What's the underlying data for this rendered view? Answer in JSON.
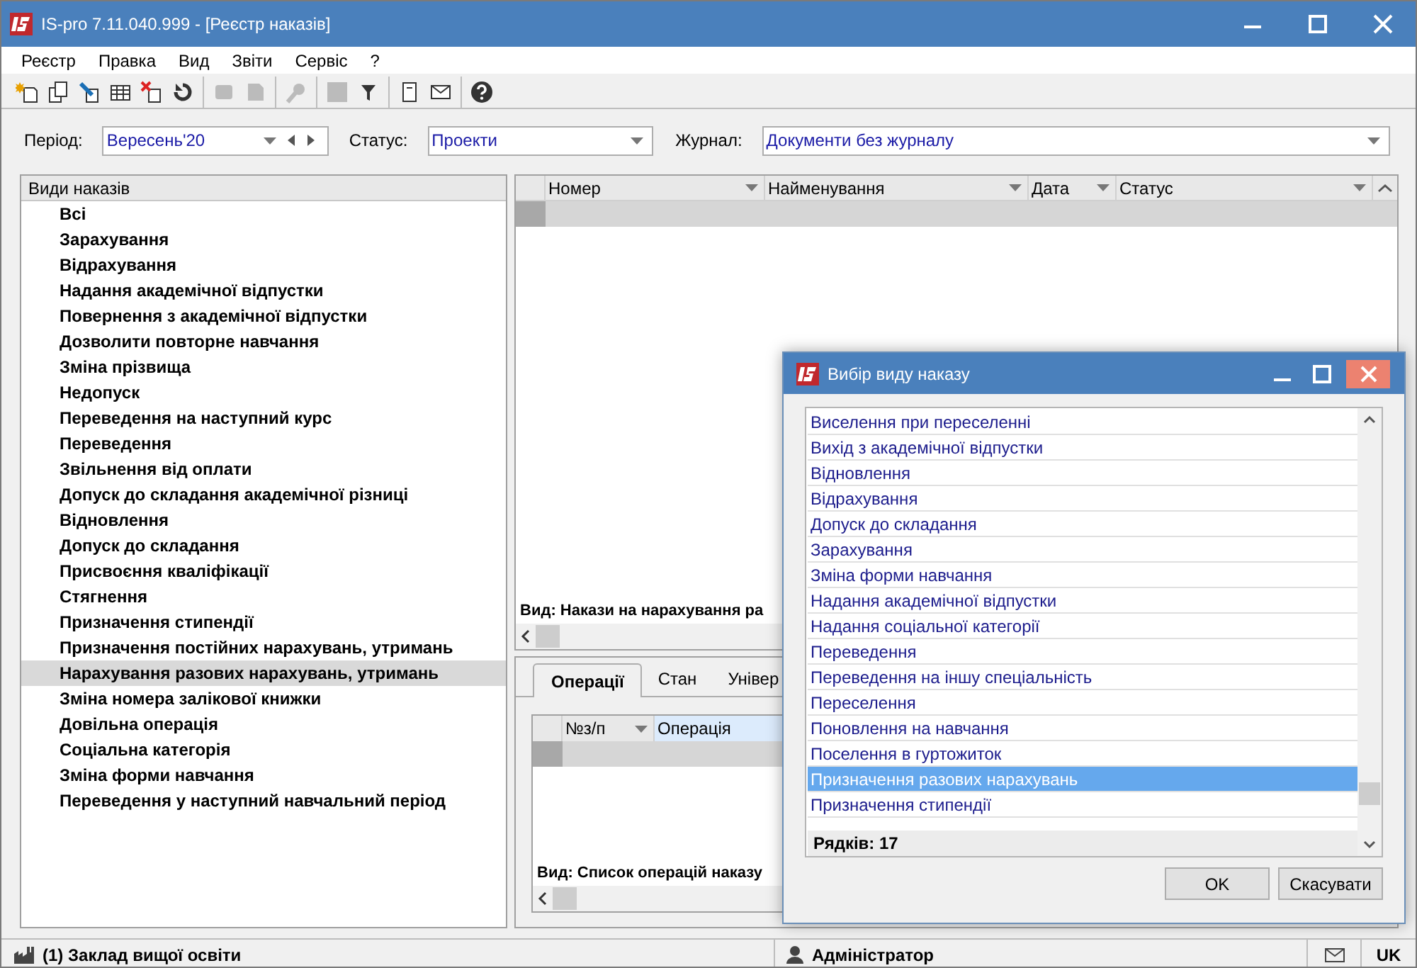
{
  "window": {
    "title": "IS-pro 7.11.040.999 - [Реєстр наказів]"
  },
  "menu": [
    "Реєстр",
    "Правка",
    "Вид",
    "Звіти",
    "Сервіс",
    "?"
  ],
  "toolbar": [
    {
      "disabled": false
    },
    {
      "disabled": false
    },
    {
      "disabled": false
    },
    {
      "disabled": false
    },
    {
      "disabled": false
    },
    {
      "disabled": false
    },
    {
      "disabled": true
    },
    {
      "disabled": true
    },
    {
      "disabled": true
    },
    {
      "disabled": true
    },
    {
      "disabled": false
    },
    {
      "disabled": false
    },
    {
      "disabled": false
    },
    {
      "disabled": false
    }
  ],
  "filters": {
    "period": {
      "label": "Період:",
      "value": "Вересень'20"
    },
    "status": {
      "label": "Статус:",
      "value": "Проекти"
    },
    "journal": {
      "label": "Журнал:",
      "value": "Документи без журналу"
    }
  },
  "order_types": {
    "header": "Види наказів",
    "items": [
      {
        "label": "Всі",
        "selected": false
      },
      {
        "label": "Зарахування",
        "selected": false
      },
      {
        "label": "Відрахування",
        "selected": false
      },
      {
        "label": "Надання академічної відпустки",
        "selected": false
      },
      {
        "label": "Повернення з академічної відпустки",
        "selected": false
      },
      {
        "label": "Дозволити повторне навчання",
        "selected": false
      },
      {
        "label": "Зміна прізвища",
        "selected": false
      },
      {
        "label": "Недопуск",
        "selected": false
      },
      {
        "label": "Переведення на наступний курс",
        "selected": false
      },
      {
        "label": "Переведення",
        "selected": false
      },
      {
        "label": "Звільнення від оплати",
        "selected": false
      },
      {
        "label": "Допуск до складання академічної різниці",
        "selected": false
      },
      {
        "label": "Відновлення",
        "selected": false
      },
      {
        "label": "Допуск до складання",
        "selected": false
      },
      {
        "label": "Присвоєння кваліфікації",
        "selected": false
      },
      {
        "label": "Стягнення",
        "selected": false
      },
      {
        "label": "Призначення стипендії",
        "selected": false
      },
      {
        "label": "Призначення постійних нарахувань, утримань",
        "selected": false
      },
      {
        "label": "Нарахування разових нарахувань, утримань",
        "selected": true
      },
      {
        "label": "Зміна номера залікової книжки",
        "selected": false
      },
      {
        "label": "Довільна операція",
        "selected": false
      },
      {
        "label": "Соціальна категорія",
        "selected": false
      },
      {
        "label": "Зміна форми навчання",
        "selected": false
      },
      {
        "label": "Переведення у наступний навчальний період",
        "selected": false
      }
    ]
  },
  "orders_grid": {
    "columns": [
      "Номер",
      "Найменування",
      "Дата",
      "Статус"
    ],
    "footer": "Вид: Накази на нарахування ра"
  },
  "detail": {
    "tabs": [
      {
        "label": "Операції",
        "selected": true
      },
      {
        "label": "Стан",
        "selected": false
      },
      {
        "label": "Універ",
        "selected": false
      }
    ],
    "columns": [
      "№з/п",
      "Операція"
    ],
    "footer": "Вид: Список операцій наказу"
  },
  "dialog": {
    "title": "Вибір виду наказу",
    "items": [
      {
        "label": "Виселення при переселенні",
        "selected": false
      },
      {
        "label": "Вихід з академічної відпустки",
        "selected": false
      },
      {
        "label": "Відновлення",
        "selected": false
      },
      {
        "label": "Відрахування",
        "selected": false
      },
      {
        "label": "Допуск до складання",
        "selected": false
      },
      {
        "label": "Зарахування",
        "selected": false
      },
      {
        "label": "Зміна форми навчання",
        "selected": false
      },
      {
        "label": "Надання академічної відпустки",
        "selected": false
      },
      {
        "label": "Надання соціальної категорії",
        "selected": false
      },
      {
        "label": "Переведення",
        "selected": false
      },
      {
        "label": "Переведення на іншу спеціальність",
        "selected": false
      },
      {
        "label": "Переселення",
        "selected": false
      },
      {
        "label": "Поновлення на навчання",
        "selected": false
      },
      {
        "label": "Поселення в гуртожиток",
        "selected": false
      },
      {
        "label": "Призначення разових нарахувань",
        "selected": true
      },
      {
        "label": "Призначення стипендії",
        "selected": false
      }
    ],
    "row_count": "Рядків: 17",
    "buttons": [
      "OK",
      "Скасувати"
    ]
  },
  "status_bar": {
    "organization": "(1) Заклад вищої освіти",
    "user": "Адміністратор",
    "language": "UK"
  }
}
